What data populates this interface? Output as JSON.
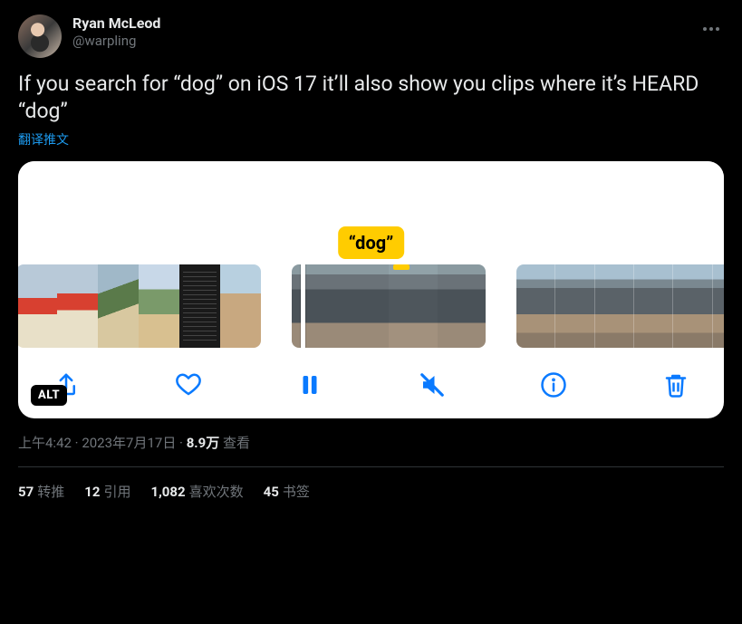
{
  "author": {
    "display_name": "Ryan McLeod",
    "handle": "@warpling"
  },
  "tweet_text": "If you search for “dog” on iOS 17 it’ll also show you clips where it’s HEARD “dog”",
  "translate_label": "翻译推文",
  "media": {
    "caption_bubble": "“dog”",
    "alt_badge": "ALT",
    "toolbar": {
      "share": "share",
      "like": "like",
      "pause": "pause",
      "mute": "mute",
      "info": "info",
      "delete": "delete"
    }
  },
  "meta": {
    "time": "上午4:42",
    "sep1": " · ",
    "date": "2023年7月17日",
    "sep2": " · ",
    "views_count": "8.9万",
    "views_label": " 查看"
  },
  "stats": {
    "retweets_count": "57",
    "retweets_label": "转推",
    "quotes_count": "12",
    "quotes_label": "引用",
    "likes_count": "1,082",
    "likes_label": "喜欢次数",
    "bookmarks_count": "45",
    "bookmarks_label": "书签"
  }
}
